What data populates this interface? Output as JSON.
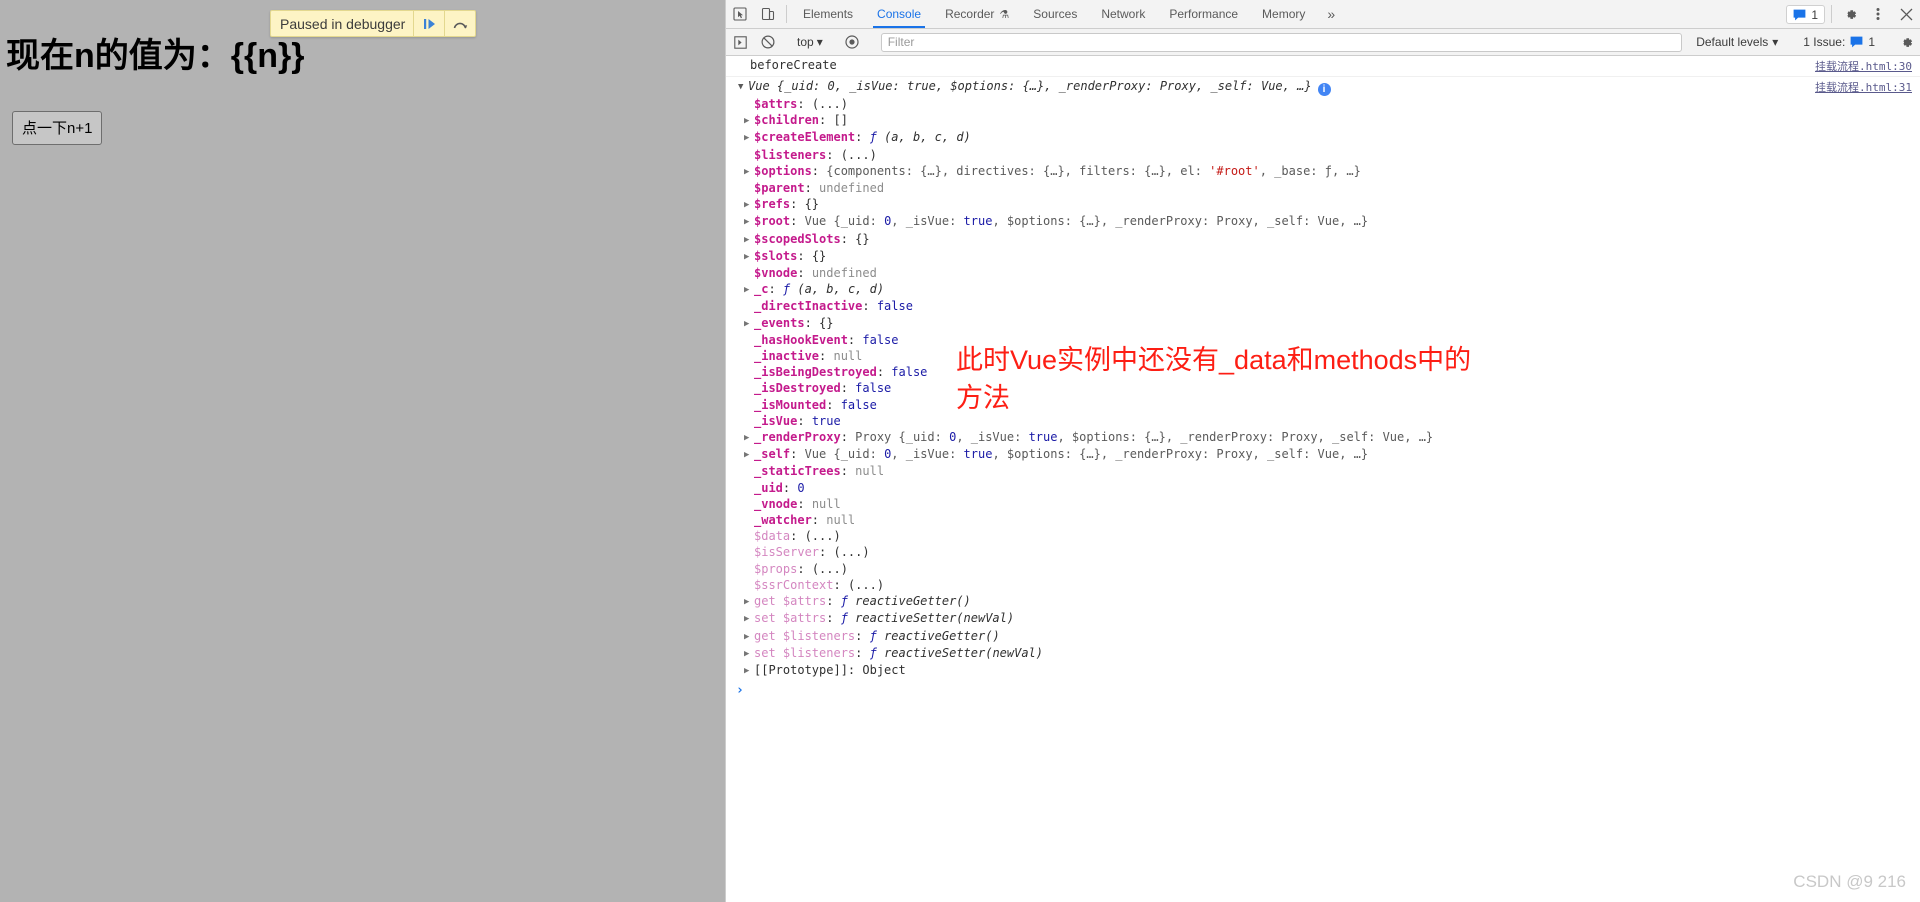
{
  "page": {
    "heading": "现在n的值为：{{n}}",
    "button_label": "点一下n+1",
    "debug_overlay": {
      "text": "Paused in debugger",
      "resume_icon": "resume-icon",
      "step_over_icon": "step-over-icon"
    }
  },
  "devtools": {
    "inspect_icon": "inspect-element-icon",
    "device_icon": "device-toolbar-icon",
    "tabs": [
      {
        "label": "Elements",
        "active": false
      },
      {
        "label": "Console",
        "active": true
      },
      {
        "label": "Recorder",
        "active": false,
        "flask": "⚗"
      },
      {
        "label": "Sources",
        "active": false
      },
      {
        "label": "Network",
        "active": false
      },
      {
        "label": "Performance",
        "active": false
      },
      {
        "label": "Memory",
        "active": false
      }
    ],
    "overflow_label": "»",
    "message_badge_count": "1",
    "settings_icon": "gear-icon",
    "more_icon": "kebab-menu-icon",
    "close_icon": "close-icon",
    "toolbar": {
      "sidebar_toggle_icon": "console-sidebar-icon",
      "clear_icon": "clear-console-icon",
      "context": "top",
      "eye_icon": "live-expression-icon",
      "filter_placeholder": "Filter",
      "filter_value": "",
      "levels_label": "Default levels",
      "issues_label": "1 Issue:",
      "issues_count": "1",
      "console_settings_icon": "gear-icon"
    }
  },
  "console": {
    "messages": [
      {
        "text": "beforeCreate",
        "source": "挂载流程.html:30"
      }
    ],
    "object": {
      "source": "挂载流程.html:31",
      "header_ctor": "Vue",
      "header_preview": "{_uid: 0, _isVue: true, $options: {…}, _renderProxy: Proxy, _self: Vue, …}",
      "info_icon": "info-icon",
      "properties": [
        {
          "expandable": false,
          "key": "$attrs",
          "style": "k",
          "value": "(...)",
          "vstyle": "plain"
        },
        {
          "expandable": true,
          "key": "$children",
          "style": "k",
          "value": "[]",
          "vstyle": "plain"
        },
        {
          "expandable": true,
          "key": "$createElement",
          "style": "k",
          "value": "ƒ (a, b, c, d)",
          "vstyle": "fn"
        },
        {
          "expandable": false,
          "key": "$listeners",
          "style": "k",
          "value": "(...)",
          "vstyle": "plain"
        },
        {
          "expandable": true,
          "key": "$options",
          "style": "k",
          "value": "{components: {…}, directives: {…}, filters: {…}, el: '#root', _base: ƒ, …}",
          "vstyle": "objpreview"
        },
        {
          "expandable": false,
          "key": "$parent",
          "style": "k",
          "value": "undefined",
          "vstyle": "gray"
        },
        {
          "expandable": true,
          "key": "$refs",
          "style": "k",
          "value": "{}",
          "vstyle": "plain"
        },
        {
          "expandable": true,
          "key": "$root",
          "style": "k",
          "value": "Vue {_uid: 0, _isVue: true, $options: {…}, _renderProxy: Proxy, _self: Vue, …}",
          "vstyle": "objpreview"
        },
        {
          "expandable": true,
          "key": "$scopedSlots",
          "style": "k",
          "value": "{}",
          "vstyle": "plain"
        },
        {
          "expandable": true,
          "key": "$slots",
          "style": "k",
          "value": "{}",
          "vstyle": "plain"
        },
        {
          "expandable": false,
          "key": "$vnode",
          "style": "k",
          "value": "undefined",
          "vstyle": "gray"
        },
        {
          "expandable": true,
          "key": "_c",
          "style": "k",
          "value": "ƒ (a, b, c, d)",
          "vstyle": "fn"
        },
        {
          "expandable": false,
          "key": "_directInactive",
          "style": "k",
          "value": "false",
          "vstyle": "bool"
        },
        {
          "expandable": true,
          "key": "_events",
          "style": "k",
          "value": "{}",
          "vstyle": "plain"
        },
        {
          "expandable": false,
          "key": "_hasHookEvent",
          "style": "k",
          "value": "false",
          "vstyle": "bool"
        },
        {
          "expandable": false,
          "key": "_inactive",
          "style": "k",
          "value": "null",
          "vstyle": "gray"
        },
        {
          "expandable": false,
          "key": "_isBeingDestroyed",
          "style": "k",
          "value": "false",
          "vstyle": "bool"
        },
        {
          "expandable": false,
          "key": "_isDestroyed",
          "style": "k",
          "value": "false",
          "vstyle": "bool"
        },
        {
          "expandable": false,
          "key": "_isMounted",
          "style": "k",
          "value": "false",
          "vstyle": "bool"
        },
        {
          "expandable": false,
          "key": "_isVue",
          "style": "k",
          "value": "true",
          "vstyle": "bool"
        },
        {
          "expandable": true,
          "key": "_renderProxy",
          "style": "k",
          "value": "Proxy {_uid: 0, _isVue: true, $options: {…}, _renderProxy: Proxy, _self: Vue, …}",
          "vstyle": "objpreview"
        },
        {
          "expandable": true,
          "key": "_self",
          "style": "k",
          "value": "Vue {_uid: 0, _isVue: true, $options: {…}, _renderProxy: Proxy, _self: Vue, …}",
          "vstyle": "objpreview"
        },
        {
          "expandable": false,
          "key": "_staticTrees",
          "style": "k",
          "value": "null",
          "vstyle": "gray"
        },
        {
          "expandable": false,
          "key": "_uid",
          "style": "k",
          "value": "0",
          "vstyle": "num"
        },
        {
          "expandable": false,
          "key": "_vnode",
          "style": "k",
          "value": "null",
          "vstyle": "gray"
        },
        {
          "expandable": false,
          "key": "_watcher",
          "style": "k",
          "value": "null",
          "vstyle": "gray"
        },
        {
          "expandable": false,
          "key": "$data",
          "style": "k-dim",
          "value": "(...)",
          "vstyle": "plain"
        },
        {
          "expandable": false,
          "key": "$isServer",
          "style": "k-dim",
          "value": "(...)",
          "vstyle": "plain"
        },
        {
          "expandable": false,
          "key": "$props",
          "style": "k-dim",
          "value": "(...)",
          "vstyle": "plain"
        },
        {
          "expandable": false,
          "key": "$ssrContext",
          "style": "k-dim",
          "value": "(...)",
          "vstyle": "plain"
        },
        {
          "expandable": true,
          "key": "get $attrs",
          "style": "k-dim",
          "value": "ƒ reactiveGetter()",
          "vstyle": "fn"
        },
        {
          "expandable": true,
          "key": "set $attrs",
          "style": "k-dim",
          "value": "ƒ reactiveSetter(newVal)",
          "vstyle": "fn"
        },
        {
          "expandable": true,
          "key": "get $listeners",
          "style": "k-dim",
          "value": "ƒ reactiveGetter()",
          "vstyle": "fn"
        },
        {
          "expandable": true,
          "key": "set $listeners",
          "style": "k-dim",
          "value": "ƒ reactiveSetter(newVal)",
          "vstyle": "fn"
        },
        {
          "expandable": true,
          "key": "[[Prototype]]",
          "style": "proto",
          "value": "Object",
          "vstyle": "plain"
        }
      ]
    },
    "prompt": "›"
  },
  "annotation": {
    "text": "此时Vue实例中还没有_data和methods中的方法",
    "color": "#fd1e14"
  },
  "watermark": "CSDN @9 216"
}
